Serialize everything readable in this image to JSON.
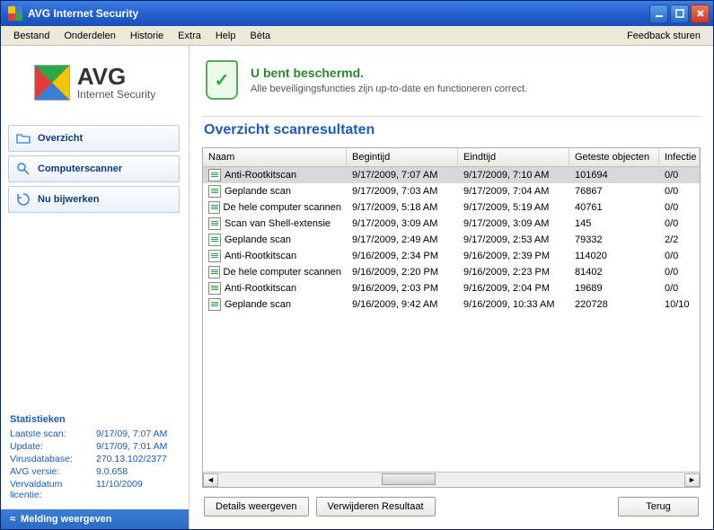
{
  "title_bar": {
    "title": "AVG Internet Security"
  },
  "menu": {
    "items": [
      "Bestand",
      "Onderdelen",
      "Historie",
      "Extra",
      "Help",
      "Bèta"
    ],
    "feedback": "Feedback sturen"
  },
  "logo": {
    "text": "AVG",
    "subtext": "Internet Security"
  },
  "sidebar": {
    "nav": [
      {
        "label": "Overzicht",
        "icon": "folder-icon"
      },
      {
        "label": "Computerscanner",
        "icon": "magnifier-icon"
      },
      {
        "label": "Nu bijwerken",
        "icon": "update-icon"
      }
    ],
    "stats_title": "Statistieken",
    "stats": [
      {
        "k": "Laatste scan:",
        "v": "9/17/09, 7:07 AM"
      },
      {
        "k": "Update:",
        "v": "9/17/09, 7:01 AM"
      },
      {
        "k": "Virusdatabase:",
        "v": "270.13.102/2377"
      },
      {
        "k": "AVG versie:",
        "v": "9.0.658"
      },
      {
        "k": "Vervaldatum licentie:",
        "v": "11/10/2009"
      }
    ],
    "melding": "Melding weergeven"
  },
  "banner": {
    "headline": "U bent beschermd.",
    "subline": "Alle beveiligingsfuncties zijn up-to-date en functioneren correct."
  },
  "content": {
    "heading": "Overzicht scanresultaten",
    "columns": [
      "Naam",
      "Begintijd",
      "Eindtijd",
      "Geteste objecten",
      "Infectie"
    ],
    "rows": [
      {
        "name": "Anti-Rootkitscan",
        "begin": "9/17/2009, 7:07 AM",
        "end": "9/17/2009, 7:10 AM",
        "tested": "101694",
        "inf": "0/0",
        "selected": true
      },
      {
        "name": "Geplande scan",
        "begin": "9/17/2009, 7:03 AM",
        "end": "9/17/2009, 7:04 AM",
        "tested": "76867",
        "inf": "0/0"
      },
      {
        "name": "De hele computer scannen",
        "begin": "9/17/2009, 5:18 AM",
        "end": "9/17/2009, 5:19 AM",
        "tested": "40761",
        "inf": "0/0"
      },
      {
        "name": "Scan van Shell-extensie",
        "begin": "9/17/2009, 3:09 AM",
        "end": "9/17/2009, 3:09 AM",
        "tested": "145",
        "inf": "0/0"
      },
      {
        "name": "Geplande scan",
        "begin": "9/17/2009, 2:49 AM",
        "end": "9/17/2009, 2:53 AM",
        "tested": "79332",
        "inf": "2/2"
      },
      {
        "name": "Anti-Rootkitscan",
        "begin": "9/16/2009, 2:34 PM",
        "end": "9/16/2009, 2:39 PM",
        "tested": "114020",
        "inf": "0/0"
      },
      {
        "name": "De hele computer scannen",
        "begin": "9/16/2009, 2:20 PM",
        "end": "9/16/2009, 2:23 PM",
        "tested": "81402",
        "inf": "0/0"
      },
      {
        "name": "Anti-Rootkitscan",
        "begin": "9/16/2009, 2:03 PM",
        "end": "9/16/2009, 2:04 PM",
        "tested": "19689",
        "inf": "0/0"
      },
      {
        "name": "Geplande scan",
        "begin": "9/16/2009, 9:42 AM",
        "end": "9/16/2009, 10:33 AM",
        "tested": "220728",
        "inf": "10/10"
      }
    ]
  },
  "buttons": {
    "details": "Details weergeven",
    "delete": "Verwijderen Resultaat",
    "back": "Terug"
  }
}
